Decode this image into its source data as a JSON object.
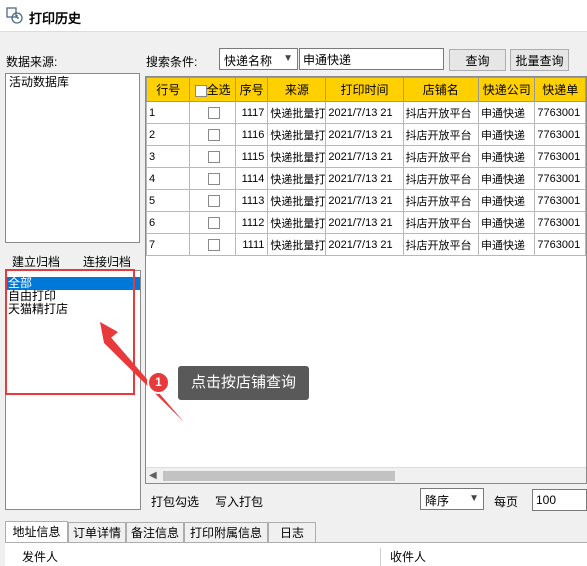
{
  "window": {
    "title": "打印历史"
  },
  "data_source": {
    "label": "数据来源:",
    "items": [
      "活动数据库"
    ]
  },
  "archive_buttons": {
    "create": "建立归档",
    "connect": "连接归档"
  },
  "shop_list": {
    "items": [
      {
        "label": "全部",
        "selected": true
      },
      {
        "label": "自由打印",
        "selected": false
      },
      {
        "label": "天猫精打店",
        "selected": false
      }
    ]
  },
  "search": {
    "label": "搜索条件:",
    "field": "快递名称",
    "value": "申通快递",
    "query_button": "查询",
    "batch_query_button": "批量查询"
  },
  "table": {
    "headers": [
      "行号",
      "全选",
      "序号",
      "来源",
      "打印时间",
      "店铺名",
      "快递公司",
      "快递单"
    ],
    "rows": [
      [
        "1",
        "",
        "1117",
        "快递批量打",
        "2021/7/13  21",
        "抖店开放平台",
        "申通快递",
        "7763001"
      ],
      [
        "2",
        "",
        "1116",
        "快递批量打",
        "2021/7/13  21",
        "抖店开放平台",
        "申通快递",
        "7763001"
      ],
      [
        "3",
        "",
        "1115",
        "快递批量打",
        "2021/7/13  21",
        "抖店开放平台",
        "申通快递",
        "7763001"
      ],
      [
        "4",
        "",
        "1114",
        "快递批量打",
        "2021/7/13  21",
        "抖店开放平台",
        "申通快递",
        "7763001"
      ],
      [
        "5",
        "",
        "1113",
        "快递批量打",
        "2021/7/13  21",
        "抖店开放平台",
        "申通快递",
        "7763001"
      ],
      [
        "6",
        "",
        "1112",
        "快递批量打",
        "2021/7/13  21",
        "抖店开放平台",
        "申通快递",
        "7763001"
      ],
      [
        "7",
        "",
        "1111",
        "快递批量打",
        "2021/7/13  21",
        "抖店开放平台",
        "申通快递",
        "7763001"
      ]
    ]
  },
  "footer": {
    "pack_check": "打包勾选",
    "write_pack": "写入打包",
    "order_value": "降序",
    "per_page_label": "每页",
    "per_page_value": "100"
  },
  "tabs": [
    "地址信息",
    "订单详情",
    "备注信息",
    "打印附属信息",
    "日志"
  ],
  "detail": {
    "sender_label": "发件人",
    "receiver_label": "收件人"
  },
  "callout": {
    "number": "1",
    "text": "点击按店铺查询"
  },
  "colors": {
    "header_yellow": "#ffd000",
    "highlight_red": "#e8393b",
    "selection_blue": "#0078d7",
    "callout_gray": "#595959"
  }
}
